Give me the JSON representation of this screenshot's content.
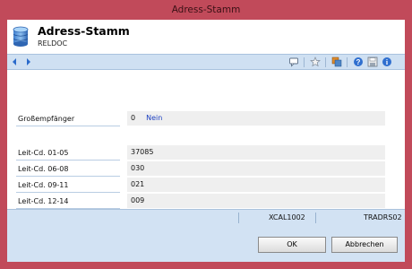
{
  "window": {
    "title": "Adress-Stamm"
  },
  "header": {
    "title": "Adress-Stamm",
    "subtitle": "RELDOC"
  },
  "toolbar": {
    "nav": [
      "back-arrow-icon",
      "forward-arrow-icon"
    ],
    "tools": [
      "comment-icon",
      "star-icon",
      "reports-icon",
      "help-icon",
      "save-icon",
      "info-icon"
    ]
  },
  "fields": [
    {
      "label": "Großempfänger",
      "value": "0",
      "value_text": "Nein"
    },
    {
      "label": "Leit-Cd. 01-05",
      "value": "37085"
    },
    {
      "label": "Leit-Cd. 06-08",
      "value": "030"
    },
    {
      "label": "Leit-Cd. 09-11",
      "value": "021"
    },
    {
      "label": "Leit-Cd. 12-14",
      "value": "009"
    }
  ],
  "status": {
    "left": "",
    "middle": "XCAL1002",
    "right": "TRADRS02"
  },
  "buttons": {
    "ok": "OK",
    "cancel": "Abbrechen"
  },
  "colors": {
    "frame": "#c14a5a",
    "toolbar": "#cfe0f2",
    "footer": "#d2e2f3",
    "link": "#1b3fc0"
  }
}
